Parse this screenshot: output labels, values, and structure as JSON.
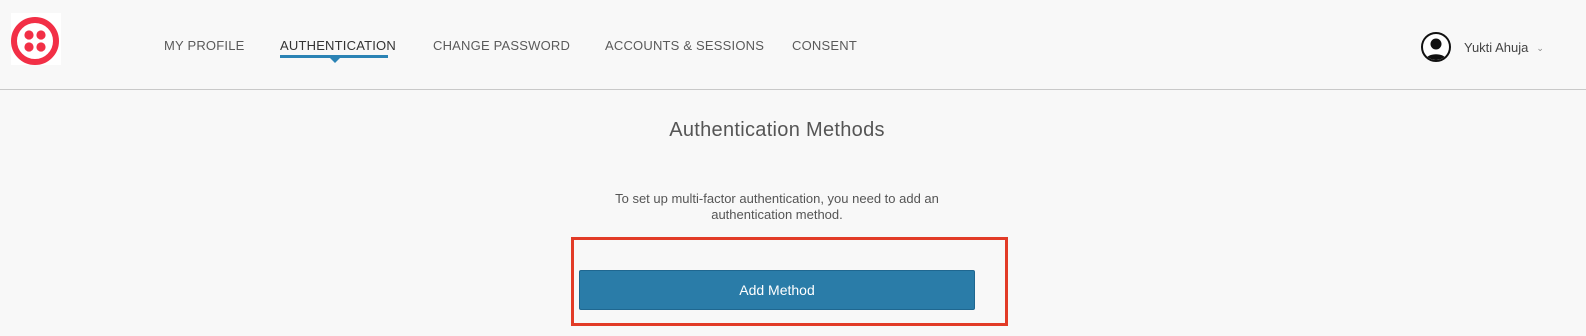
{
  "brand": {
    "logo_icon": "twilio-logo-icon",
    "logo_color": "#f22f46"
  },
  "nav": {
    "items": [
      {
        "label": "MY PROFILE",
        "active": false
      },
      {
        "label": "AUTHENTICATION",
        "active": true
      },
      {
        "label": "CHANGE PASSWORD",
        "active": false
      },
      {
        "label": "ACCOUNTS & SESSIONS",
        "active": false
      },
      {
        "label": "CONSENT",
        "active": false
      }
    ],
    "active_color": "#2b83b5"
  },
  "user": {
    "name": "Yukti Ahuja",
    "avatar_icon": "user-avatar-icon",
    "menu_icon": "chevron-down-icon"
  },
  "main": {
    "title": "Authentication Methods",
    "intro": "To set up multi-factor authentication, you need to add an authentication method.",
    "add_button_label": "Add Method",
    "button_color": "#2a7ca8",
    "highlight_color": "#e23b27"
  }
}
